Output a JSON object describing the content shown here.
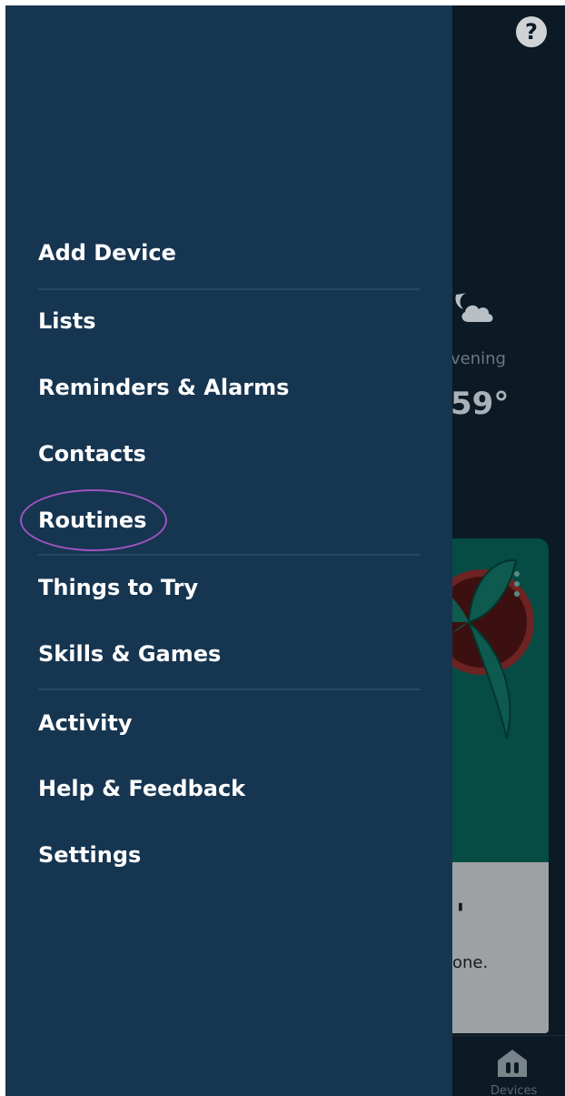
{
  "background": {
    "help_icon": "question-mark-icon",
    "weather": {
      "icon": "partly-cloudy-night-icon",
      "label": "vening",
      "temperature": "59°"
    },
    "gray_card": {
      "mark": "'",
      "text": "one."
    },
    "bottom_nav": {
      "devices_label": "Devices",
      "devices_icon": "devices-icon"
    }
  },
  "drawer": {
    "items": [
      {
        "label": "Add Device"
      },
      {
        "label": "Lists"
      },
      {
        "label": "Reminders & Alarms"
      },
      {
        "label": "Contacts"
      },
      {
        "label": "Routines"
      },
      {
        "label": "Things to Try"
      },
      {
        "label": "Skills & Games"
      },
      {
        "label": "Activity"
      },
      {
        "label": "Help & Feedback"
      },
      {
        "label": "Settings"
      }
    ],
    "highlighted_item": "Routines",
    "highlight_color": "#a154bf",
    "background_color": "#163550"
  }
}
